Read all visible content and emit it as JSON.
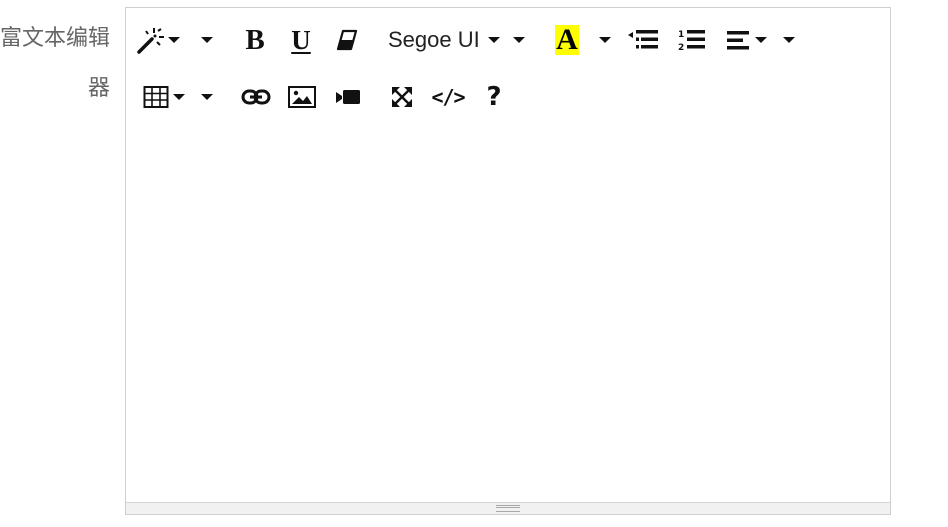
{
  "field": {
    "label": "富文本编辑器"
  },
  "toolbar": {
    "font_name": "Segoe UI",
    "font_color_letter": "A",
    "bold_letter": "B",
    "underline_letter": "U",
    "help_glyph": "?",
    "code_glyph": "</>",
    "highlight_color": "#ffff00"
  },
  "editor": {
    "content": ""
  }
}
